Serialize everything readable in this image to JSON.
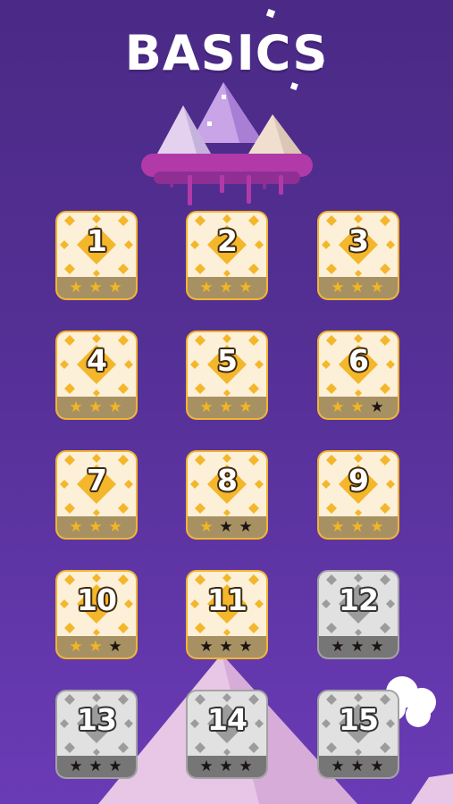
{
  "title": "BASICS",
  "colors": {
    "background": "#553096",
    "tile_unlocked": "#fdf0d8",
    "tile_accent": "#f4b62a",
    "tile_locked": "#e1e1e1",
    "star_earned": "#f3b623",
    "star_empty": "#1b1410"
  },
  "levels": [
    {
      "number": "1",
      "locked": false,
      "stars": 3
    },
    {
      "number": "2",
      "locked": false,
      "stars": 3
    },
    {
      "number": "3",
      "locked": false,
      "stars": 3
    },
    {
      "number": "4",
      "locked": false,
      "stars": 3
    },
    {
      "number": "5",
      "locked": false,
      "stars": 3
    },
    {
      "number": "6",
      "locked": false,
      "stars": 2
    },
    {
      "number": "7",
      "locked": false,
      "stars": 3
    },
    {
      "number": "8",
      "locked": false,
      "stars": 1
    },
    {
      "number": "9",
      "locked": false,
      "stars": 3
    },
    {
      "number": "10",
      "locked": false,
      "stars": 2
    },
    {
      "number": "11",
      "locked": false,
      "stars": 0
    },
    {
      "number": "12",
      "locked": true,
      "stars": 0
    },
    {
      "number": "13",
      "locked": true,
      "stars": 0
    },
    {
      "number": "14",
      "locked": true,
      "stars": 0
    },
    {
      "number": "15",
      "locked": true,
      "stars": 0
    }
  ],
  "star_glyph": "★",
  "icons": [
    "floating-island-icon",
    "mountain-icon",
    "cloud-icon",
    "star-icon"
  ]
}
